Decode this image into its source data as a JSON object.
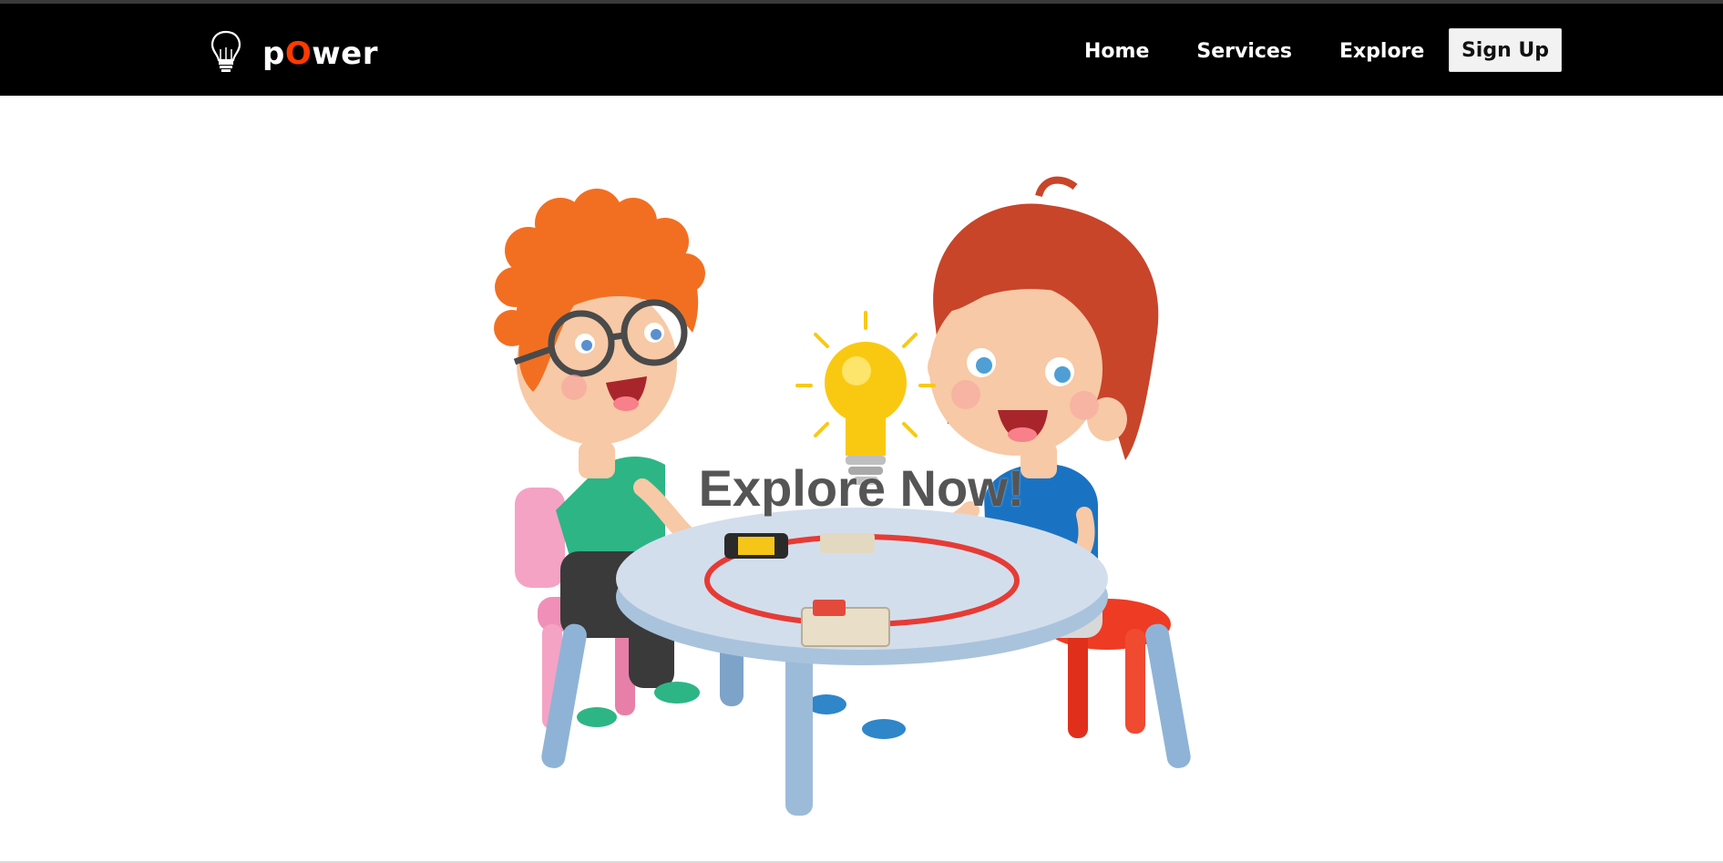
{
  "brand": {
    "name_prefix": "p",
    "name_accent": "O",
    "name_suffix": "wer",
    "accent_color": "#ff3a00",
    "logo_icon": "lightbulb-icon"
  },
  "nav": {
    "links": [
      {
        "label": "Home"
      },
      {
        "label": "Services"
      },
      {
        "label": "Explore"
      }
    ],
    "signup_label": "Sign Up"
  },
  "hero": {
    "cta_text": "Explore Now!",
    "illustration": "kids-circuit-experiment-illustration"
  },
  "colors": {
    "navbar_bg": "#000000",
    "page_bg": "#ffffff",
    "cta_text": "#555555"
  }
}
